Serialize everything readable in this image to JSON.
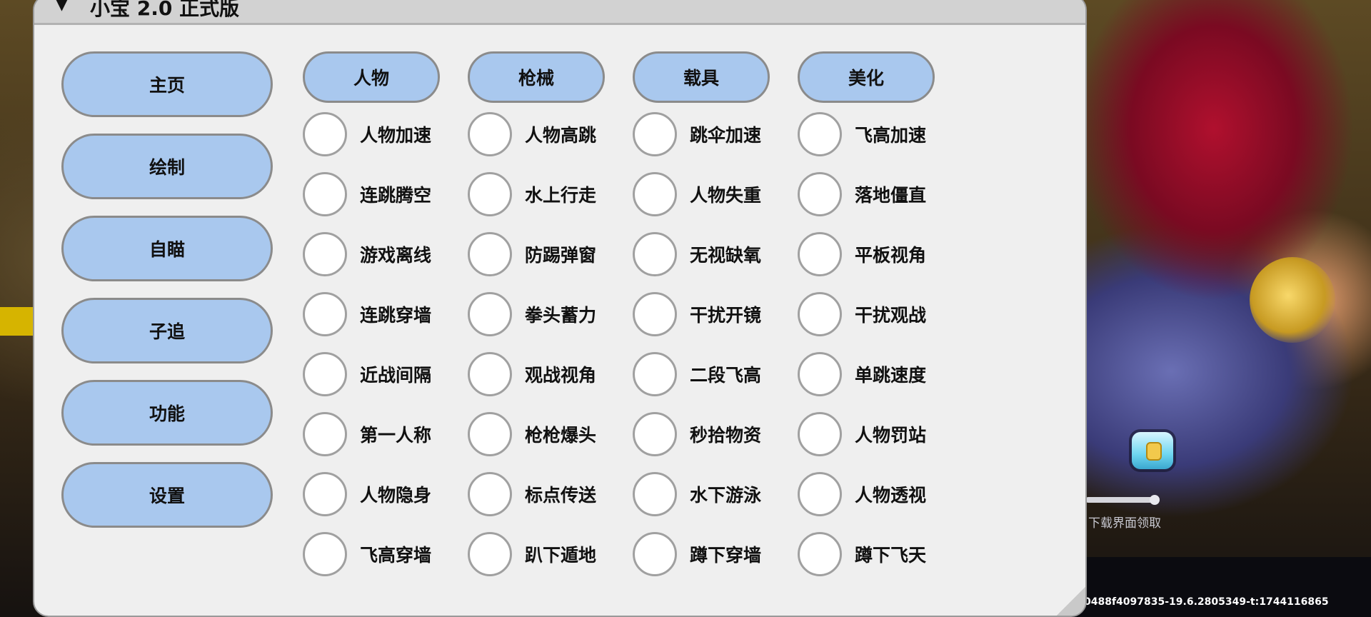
{
  "window": {
    "collapse_arrow": "▼",
    "title": "小宝 2.0 正式版"
  },
  "sidebar": {
    "items": [
      {
        "label": "主页"
      },
      {
        "label": "绘制"
      },
      {
        "label": "自瞄"
      },
      {
        "label": "子追"
      },
      {
        "label": "功能"
      },
      {
        "label": "设置"
      }
    ]
  },
  "tabs": [
    {
      "label": "人物"
    },
    {
      "label": "枪械"
    },
    {
      "label": "载具"
    },
    {
      "label": "美化"
    }
  ],
  "features": {
    "columns": [
      [
        "人物加速",
        "连跳腾空",
        "游戏离线",
        "连跳穿墙",
        "近战间隔",
        "第一人称",
        "人物隐身",
        "飞高穿墙"
      ],
      [
        "人物高跳",
        "水上行走",
        "防踢弹窗",
        "拳头蓄力",
        "观战视角",
        "枪枪爆头",
        "标点传送",
        "趴下遁地"
      ],
      [
        "跳伞加速",
        "人物失重",
        "无视缺氧",
        "干扰开镜",
        "二段飞高",
        "秒拾物资",
        "水下游泳",
        "蹲下穿墙"
      ],
      [
        "飞高加速",
        "落地僵直",
        "平板视角",
        "干扰观战",
        "单跳速度",
        "人物罚站",
        "人物透视",
        "蹲下飞天"
      ]
    ]
  },
  "game": {
    "claim_hint": "下载界面领取",
    "build_info": "0488f4097835-19.6.2805349-t:1744116865"
  },
  "colors": {
    "button_fill": "#a9c8ee",
    "button_border": "#8b8b8b",
    "panel_bg": "#efefef",
    "title_bar": "#d2d2d2"
  }
}
